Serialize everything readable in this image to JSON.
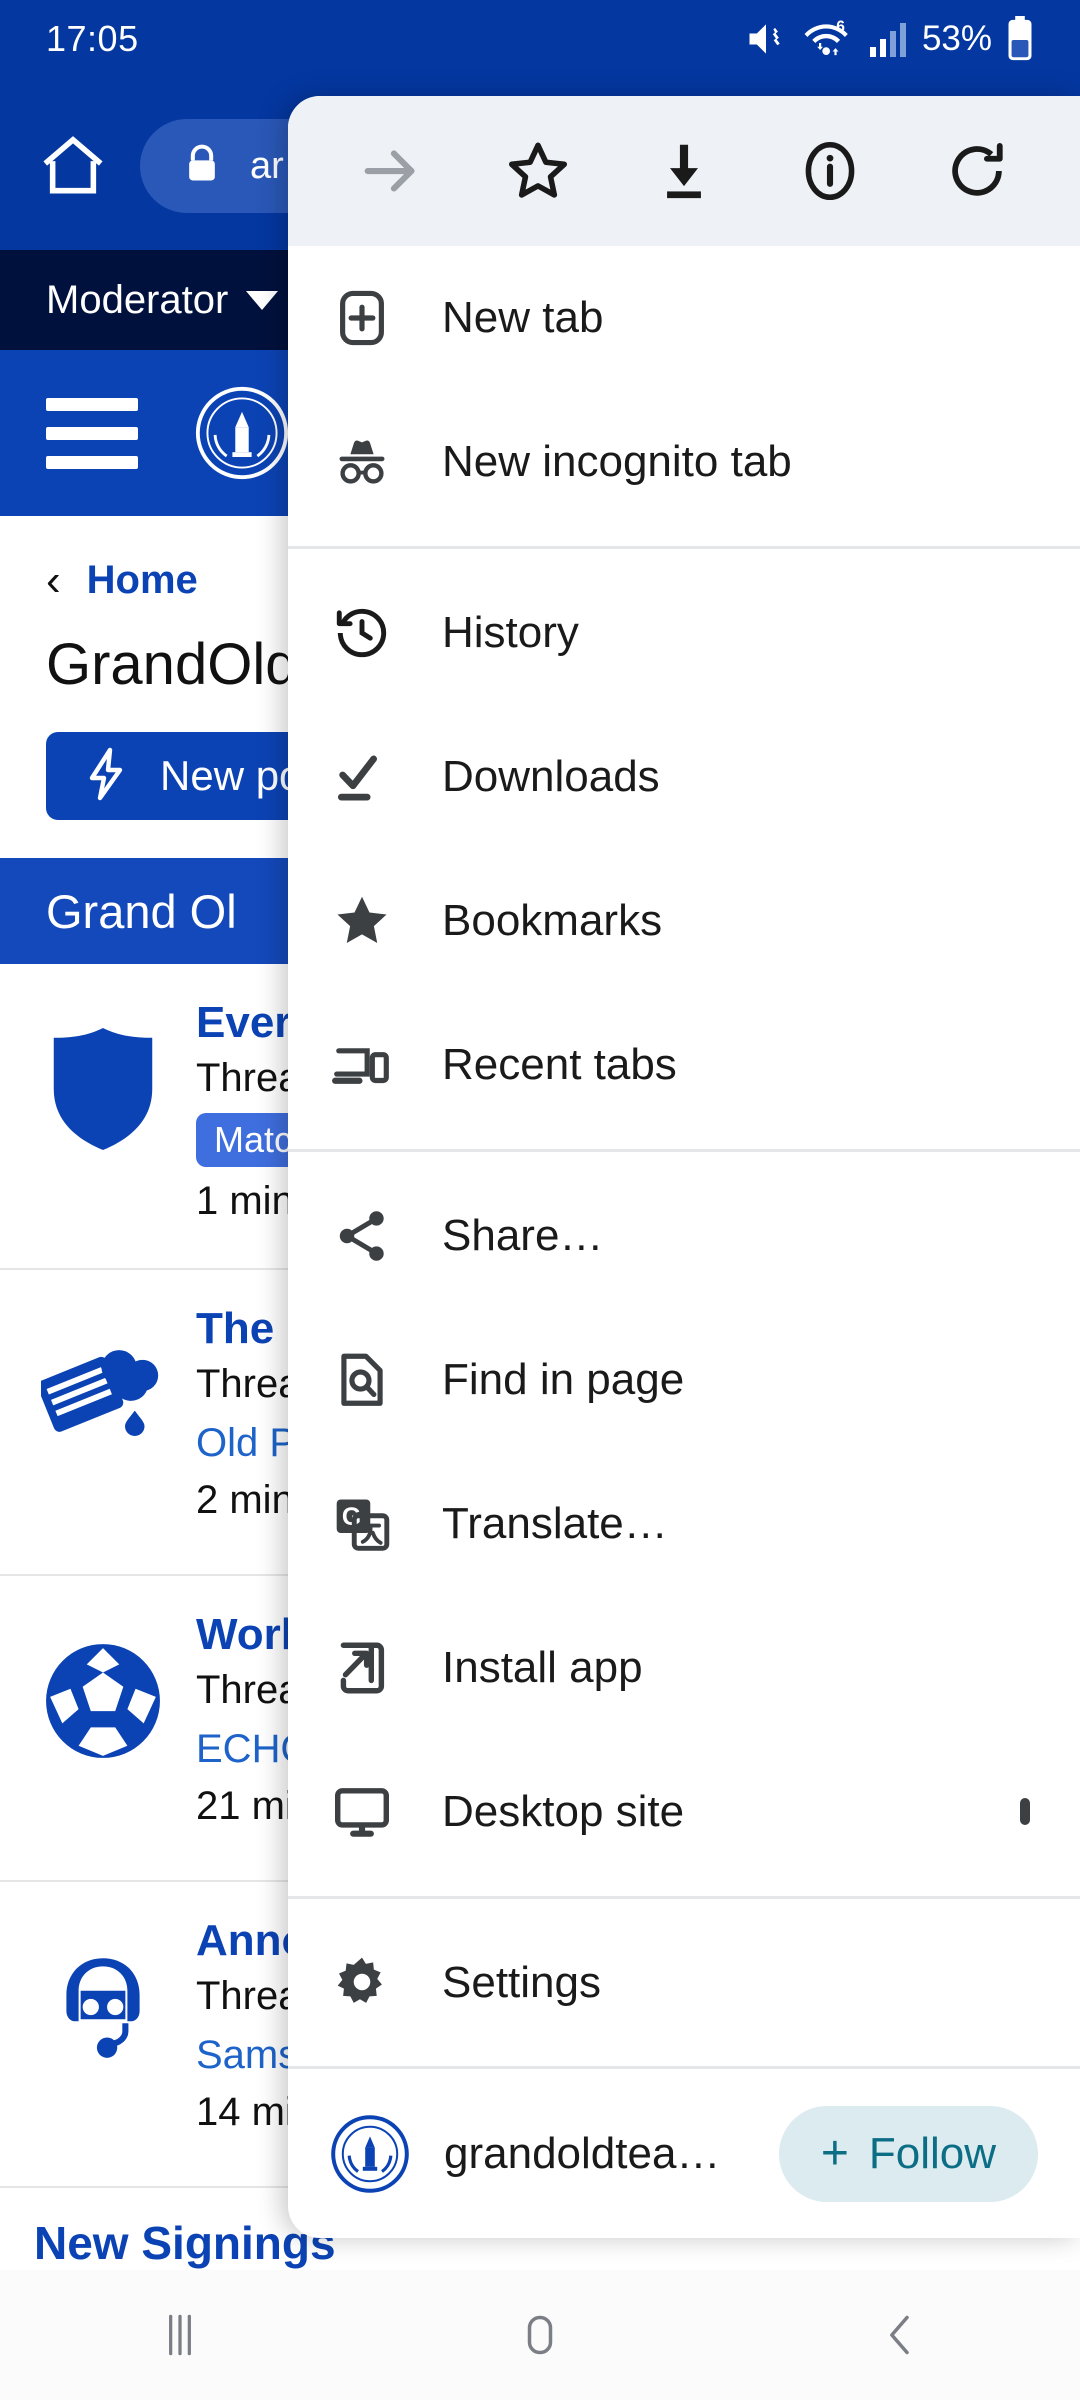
{
  "statusbar": {
    "clock": "17:05",
    "battery_percent": "53%",
    "icons": [
      "mute-icon",
      "wifi6-icon",
      "signal-bars-icon",
      "battery-icon"
    ]
  },
  "browser_toolbar": {
    "home_icon": "home-icon",
    "lock_icon": "lock-icon",
    "url_text": "ar"
  },
  "page": {
    "moderator_bar": {
      "label": "Moderator",
      "caret": "chevron-down-icon"
    },
    "site_header": {
      "menu_icon": "hamburger-icon",
      "logo": "site-logo"
    },
    "breadcrumb": {
      "back": "‹",
      "home": "Home"
    },
    "title": "GrandOld",
    "new_post_button": {
      "icon": "lightning-bolt-icon",
      "label": "New po"
    },
    "active_tab": "Grand Ol",
    "threads": [
      {
        "icon": "shield-icon",
        "title": "Ever",
        "subtitle": "Threa",
        "tag": "Match",
        "link": "",
        "time": "1 min"
      },
      {
        "icon": "newspaper-rain-icon",
        "title": "The",
        "subtitle": "Threa",
        "tag": "",
        "link": "Old P",
        "time": "2 min"
      },
      {
        "icon": "football-icon",
        "title": "Worl",
        "subtitle": "Threa",
        "tag": "",
        "link": "ECHO",
        "time": "21 mi"
      },
      {
        "icon": "headset-person-icon",
        "title": "Anno",
        "subtitle": "Threa",
        "tag": "",
        "link": "Sams",
        "time": "14 mi"
      }
    ],
    "last_partial_thread": "New Signings"
  },
  "menu": {
    "header_actions": [
      {
        "name": "forward-arrow-icon",
        "label": "Forward",
        "disabled": true
      },
      {
        "name": "star-outline-icon",
        "label": "Bookmark"
      },
      {
        "name": "download-icon",
        "label": "Download"
      },
      {
        "name": "info-circle-icon",
        "label": "Page info"
      },
      {
        "name": "reload-icon",
        "label": "Reload"
      }
    ],
    "groups": [
      {
        "items": [
          {
            "icon": "new-tab-icon",
            "label": "New tab"
          },
          {
            "icon": "incognito-icon",
            "label": "New incognito tab"
          }
        ]
      },
      {
        "items": [
          {
            "icon": "history-icon",
            "label": "History"
          },
          {
            "icon": "downloads-icon",
            "label": "Downloads"
          },
          {
            "icon": "bookmarks-star-icon",
            "label": "Bookmarks"
          },
          {
            "icon": "recent-tabs-icon",
            "label": "Recent tabs"
          }
        ]
      },
      {
        "items": [
          {
            "icon": "share-icon",
            "label": "Share…"
          },
          {
            "icon": "find-in-page-icon",
            "label": "Find in page"
          },
          {
            "icon": "translate-icon",
            "label": "Translate…"
          },
          {
            "icon": "install-app-icon",
            "label": "Install app"
          },
          {
            "icon": "desktop-site-icon",
            "label": "Desktop site",
            "checkbox": false
          }
        ]
      },
      {
        "items": [
          {
            "icon": "gear-icon",
            "label": "Settings"
          }
        ]
      }
    ],
    "footer": {
      "site_icon": "site-logo",
      "site_name": "grandoldtea…",
      "follow_plus": "+",
      "follow_label": "Follow"
    }
  },
  "navbar": {
    "recents_icon": "recents-icon",
    "home_icon": "home-square-icon",
    "back_icon": "back-chevron-icon"
  },
  "colors": {
    "brand_blue": "#0437a0",
    "header_blue": "#0c43b4",
    "dark_navy": "#00113d",
    "menu_header_bg": "#eef2f6",
    "follow_bg": "#dcebf0",
    "follow_fg": "#0c6e85"
  }
}
